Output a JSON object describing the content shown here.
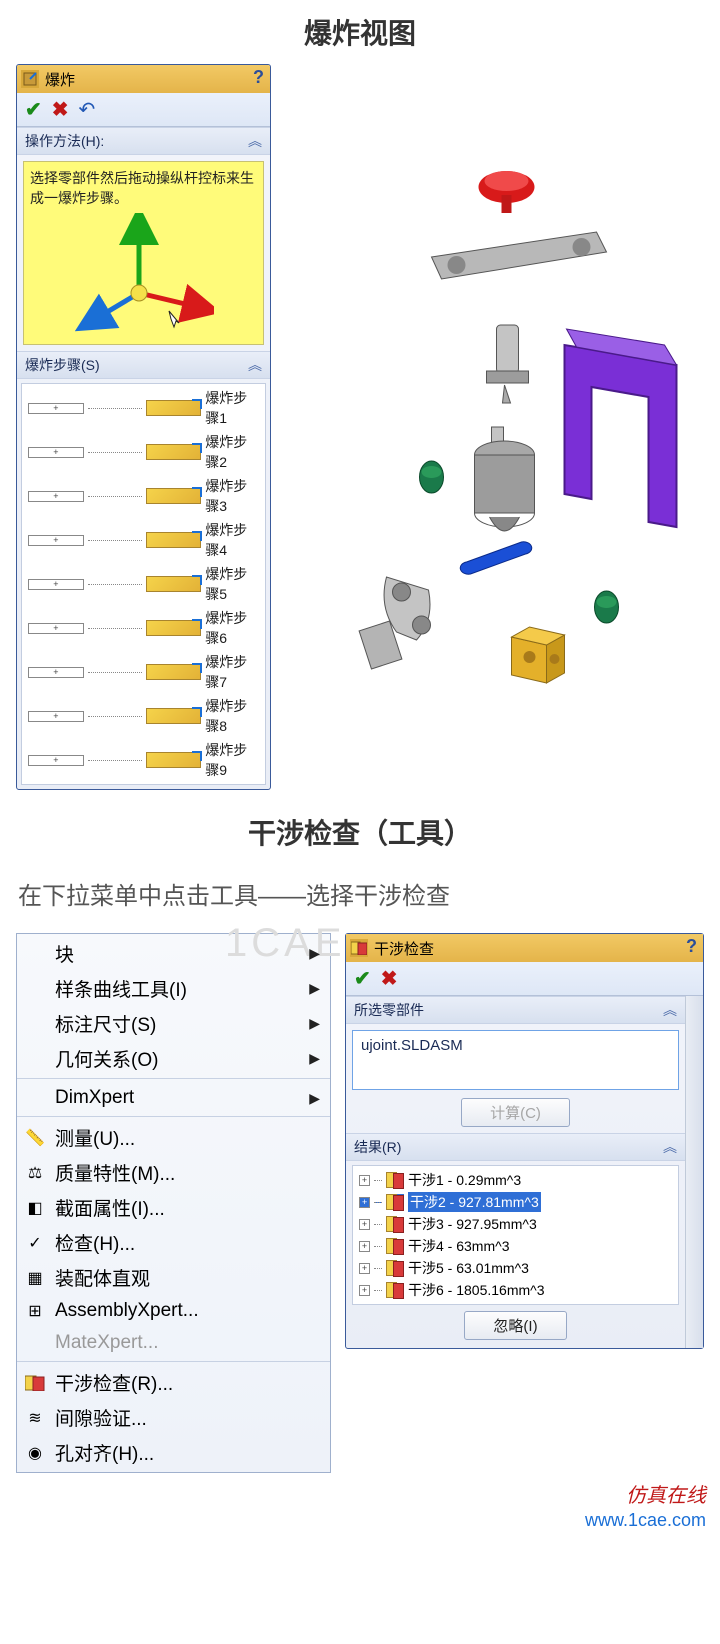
{
  "section1_title": "爆炸视图",
  "explode_panel": {
    "title": "爆炸",
    "help": "?",
    "method_header": "操作方法(H):",
    "method_text": "选择零部件然后拖动操纵杆控标来生成一爆炸步骤。",
    "steps_header": "爆炸步骤(S)",
    "steps": [
      "爆炸步骤1",
      "爆炸步骤2",
      "爆炸步骤3",
      "爆炸步骤4",
      "爆炸步骤5",
      "爆炸步骤6",
      "爆炸步骤7",
      "爆炸步骤8",
      "爆炸步骤9"
    ]
  },
  "section2_title": "干涉检查（工具）",
  "instruction": "在下拉菜单中点击工具——选择干涉检查",
  "menu": {
    "items": [
      {
        "label": "块",
        "arrow": true,
        "icon": ""
      },
      {
        "label": "样条曲线工具(I)",
        "arrow": true,
        "icon": ""
      },
      {
        "label": "标注尺寸(S)",
        "arrow": true,
        "icon": ""
      },
      {
        "label": "几何关系(O)",
        "arrow": true,
        "icon": "",
        "sep": true
      },
      {
        "label": "DimXpert",
        "arrow": true,
        "icon": "",
        "sep": true
      },
      {
        "label": "测量(U)...",
        "icon": "measure"
      },
      {
        "label": "质量特性(M)...",
        "icon": "mass"
      },
      {
        "label": "截面属性(I)...",
        "icon": "section"
      },
      {
        "label": "检查(H)...",
        "icon": "check"
      },
      {
        "label": "装配体直观",
        "icon": "assembly"
      },
      {
        "label": "AssemblyXpert...",
        "icon": "axpert"
      },
      {
        "label": "MateXpert...",
        "disabled": true,
        "sep": true
      },
      {
        "label": "干涉检查(R)...",
        "icon": "interf"
      },
      {
        "label": "间隙验证...",
        "icon": "clear"
      },
      {
        "label": "孔对齐(H)...",
        "icon": "hole"
      }
    ]
  },
  "interf_panel": {
    "title": "干涉检查",
    "selcomp_header": "所选零部件",
    "selcomp_value": "ujoint.SLDASM",
    "calc_label": "计算(C)",
    "results_header": "结果(R)",
    "results": [
      {
        "label": "干涉1 - 0.29mm^3"
      },
      {
        "label": "干涉2 - 927.81mm^3",
        "selected": true
      },
      {
        "label": "干涉3 - 927.95mm^3"
      },
      {
        "label": "干涉4 - 63mm^3"
      },
      {
        "label": "干涉5 - 63.01mm^3"
      },
      {
        "label": "干涉6 - 1805.16mm^3"
      }
    ],
    "ignore_label": "忽略(I)"
  },
  "watermark": "1CAE",
  "footer_brand": "仿真在线",
  "footer_url": "www.1cae.com"
}
